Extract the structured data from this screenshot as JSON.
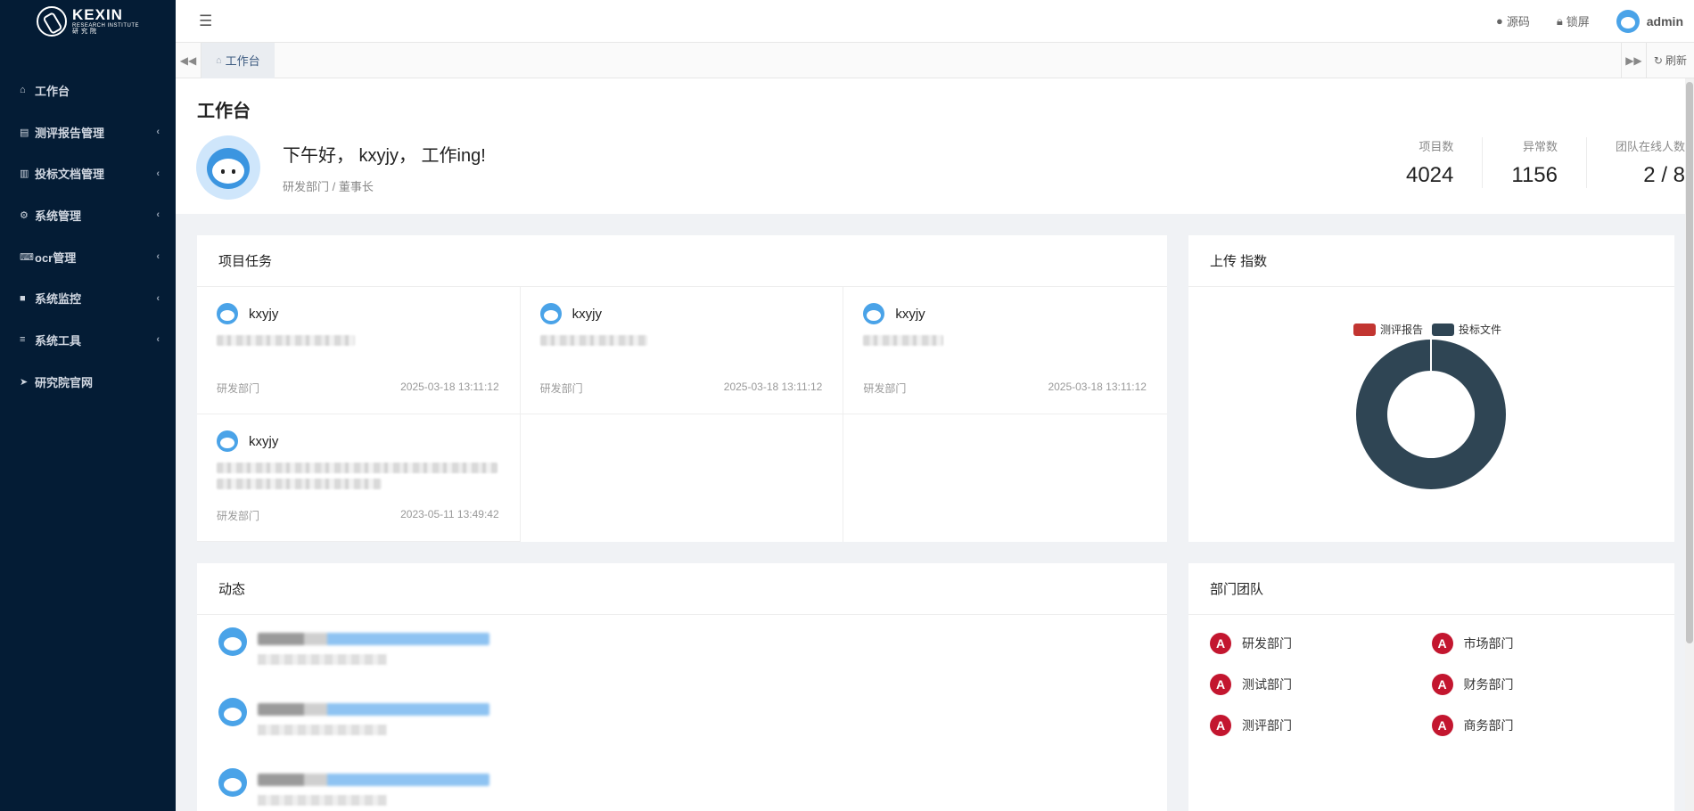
{
  "app": {
    "logo_title": "KEXIN",
    "logo_subtitle": "RESEARCH INSTITUTE",
    "logo_cn": "研究院"
  },
  "sidebar": {
    "items": [
      {
        "label": "工作台",
        "icon": "home-icon",
        "has_children": false
      },
      {
        "label": "测评报告管理",
        "icon": "file-excel-icon",
        "has_children": true
      },
      {
        "label": "投标文档管理",
        "icon": "file-text-icon",
        "has_children": true
      },
      {
        "label": "系统管理",
        "icon": "gear-icon",
        "has_children": true
      },
      {
        "label": "ocr管理",
        "icon": "keyboard-icon",
        "has_children": true
      },
      {
        "label": "系统监控",
        "icon": "video-camera-icon",
        "has_children": true
      },
      {
        "label": "系统工具",
        "icon": "list-icon",
        "has_children": true
      },
      {
        "label": "研究院官网",
        "icon": "location-arrow-icon",
        "has_children": false
      }
    ]
  },
  "topbar": {
    "source_label": "源码",
    "lock_label": "锁屏",
    "username": "admin"
  },
  "tabs": {
    "items": [
      {
        "label": "工作台",
        "active": true
      }
    ],
    "refresh_label": "刷新"
  },
  "welcome": {
    "page_title": "工作台",
    "greeting": "下午好， kxyjy， 工作ing!",
    "department": "研发部门 / 董事长",
    "stats": [
      {
        "label": "项目数",
        "value": "4024"
      },
      {
        "label": "异常数",
        "value": "1156"
      },
      {
        "label": "团队在线人数",
        "value": "2 / 8"
      }
    ]
  },
  "projects": {
    "title": "项目任务",
    "items": [
      {
        "name": "kxyjy",
        "dept": "研发部门",
        "time": "2025-03-18 13:11:12"
      },
      {
        "name": "kxyjy",
        "dept": "研发部门",
        "time": "2025-03-18 13:11:12"
      },
      {
        "name": "kxyjy",
        "dept": "研发部门",
        "time": "2025-03-18 13:11:12"
      },
      {
        "name": "kxyjy",
        "dept": "研发部门",
        "time": "2023-05-11 13:49:42"
      }
    ]
  },
  "upload_index": {
    "title": "上传 指数"
  },
  "chart_data": {
    "type": "pie",
    "variant": "donut",
    "title": "",
    "legend_position": "top",
    "series": [
      {
        "name": "测评报告",
        "value": 0,
        "color": "#c23531"
      },
      {
        "name": "投标文件",
        "value": 1,
        "color": "#2f4554"
      }
    ]
  },
  "activity": {
    "title": "动态",
    "count": 3
  },
  "teams": {
    "title": "部门团队",
    "items": [
      "研发部门",
      "市场部门",
      "测试部门",
      "财务部门",
      "测评部门",
      "商务部门"
    ]
  }
}
